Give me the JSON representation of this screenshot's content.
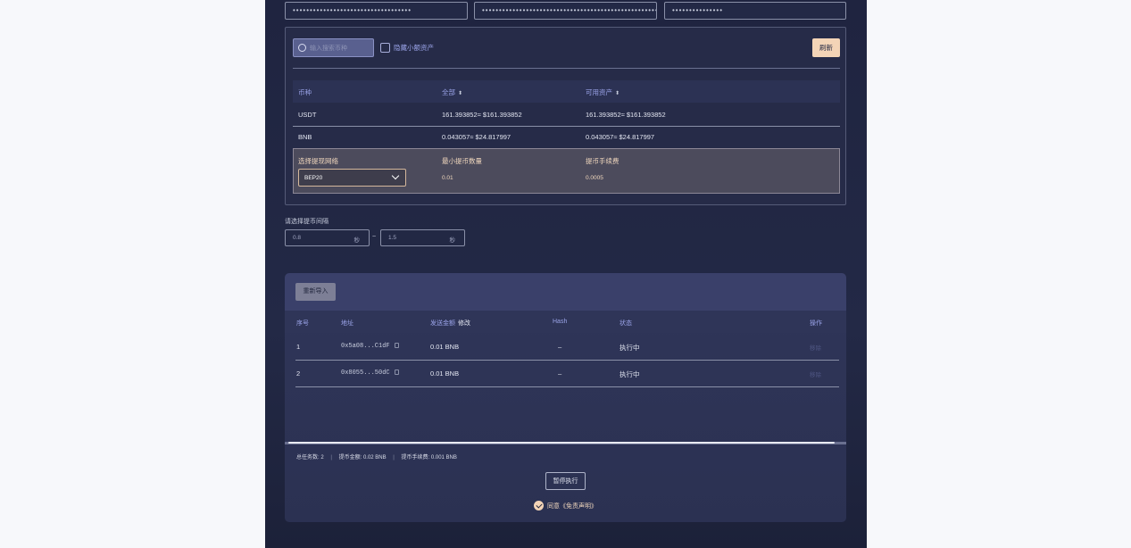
{
  "keys": [
    "•••••••••••••••••••••••••••••••••••",
    "••••••••••••••••••••••••••••••••••••••••••••••••••••••••••••",
    "•••••••••••••••"
  ],
  "assets": {
    "search_placeholder": "输入搜索币种",
    "hide_small_label": "隐藏小额资产",
    "refresh_label": "刷新",
    "headers": {
      "coin": "币种",
      "total": "全部",
      "available": "可用资产"
    },
    "rows": [
      {
        "coin": "USDT",
        "total": "161.393852≈ $161.393852",
        "available": "161.393852≈ $161.393852"
      },
      {
        "coin": "BNB",
        "total": "0.043057≈ $24.817997",
        "available": "0.043057≈ $24.817997"
      }
    ],
    "network": {
      "select_label": "选择提现网络",
      "min_label": "最小提币数量",
      "fee_label": "提币手续费",
      "selected": "BEP20",
      "min_value": "0.01",
      "fee_value": "0.0005"
    }
  },
  "interval": {
    "label": "请选择提币间隔",
    "from": "0.8",
    "to": "1.5",
    "unit": "秒",
    "separator": "~"
  },
  "tasks": {
    "reimport_label": "重新导入",
    "headers": {
      "index": "序号",
      "address": "地址",
      "amount": "发送金额",
      "amount_edit": "修改",
      "hash": "Hash",
      "status": "状态",
      "action": "操作"
    },
    "rows": [
      {
        "index": "1",
        "address": "0x5a08...C1dF",
        "amount": "0.01 BNB",
        "hash": "–",
        "status": "执行中",
        "action": "移除"
      },
      {
        "index": "2",
        "address": "0x8055...50dC",
        "amount": "0.01 BNB",
        "hash": "–",
        "status": "执行中",
        "action": "移除"
      }
    ],
    "summary": {
      "total_label": "总任务数:",
      "total_value": "2",
      "amount_label": "提币金额:",
      "amount_value": "0.02 BNB",
      "fee_label": "提币手续费:",
      "fee_value": "0.001 BNB"
    },
    "pause_label": "暂停执行",
    "agree_label": "同意《免责声明》"
  }
}
